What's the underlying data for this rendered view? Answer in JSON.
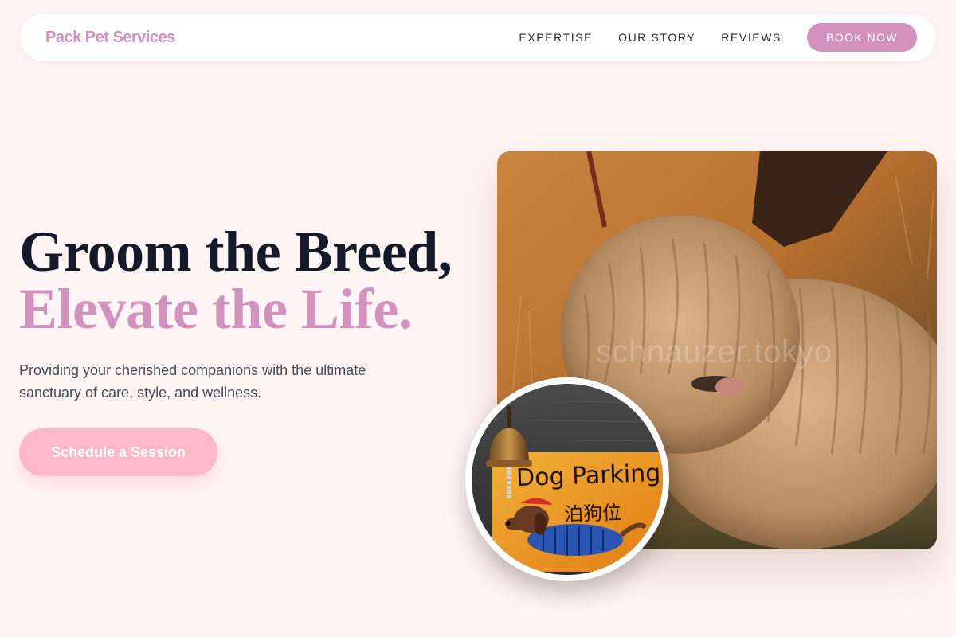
{
  "brand": "Pack Pet Services",
  "nav": {
    "links": [
      "EXPERTISE",
      "OUR STORY",
      "REVIEWS"
    ],
    "cta": "BOOK NOW"
  },
  "hero": {
    "title_line1": "Groom the Breed,",
    "title_line2": "Elevate the Life.",
    "subtitle": "Providing your cherished companions with the ultimate sanctuary of care, style, and wellness.",
    "cta": "Schedule a Session"
  },
  "images": {
    "main_watermark": "schnauzer.tokyo",
    "sign_text": "Dog Parking",
    "sign_cn": "泊狗位"
  },
  "colors": {
    "background": "#fff5f5",
    "accent": "#d391bd",
    "cta_pink": "#ffb7c9",
    "heading": "#141a2a"
  }
}
